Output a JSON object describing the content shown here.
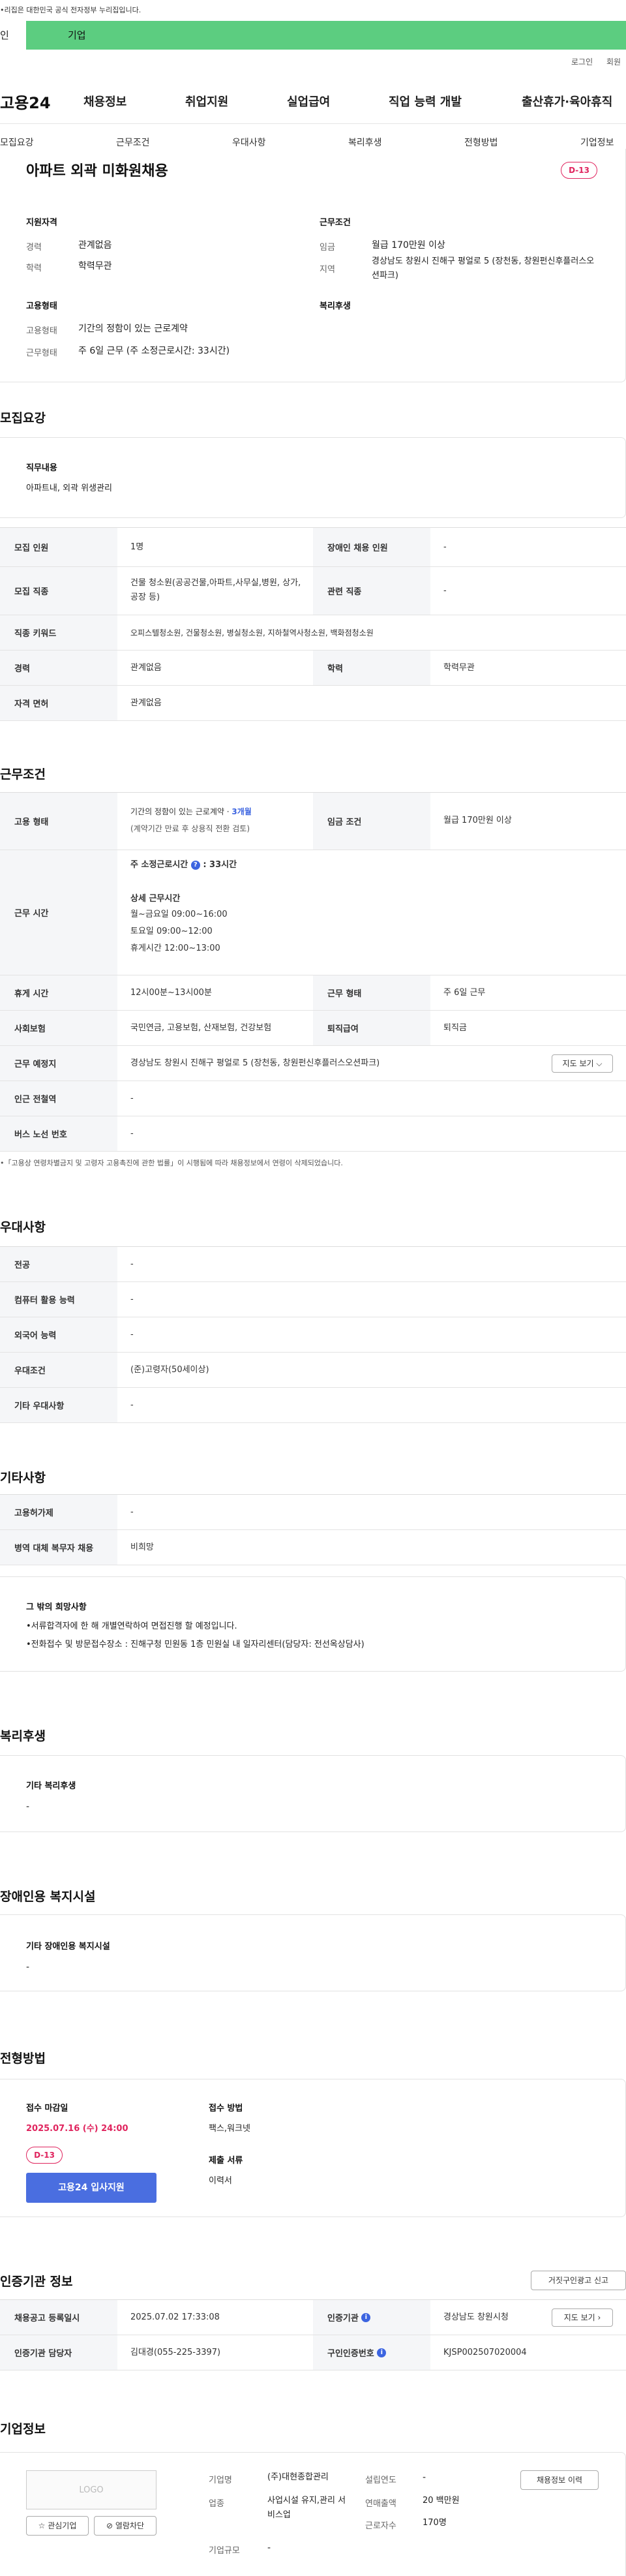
{
  "top": {
    "gov_notice": "•리집은 대한민국 공식 전자정부 누리집입니다.",
    "tab_personal": "인",
    "tab_company": "기업",
    "login": "로그인",
    "signup": "회원"
  },
  "gnb": {
    "logo": "고용24",
    "items": [
      "채용정보",
      "취업지원",
      "실업급여",
      "직업 능력 개발",
      "출산휴가·육아휴직"
    ]
  },
  "subnav": [
    "모집요강",
    "근무조건",
    "우대사항",
    "복리후생",
    "전형방법",
    "기업정보"
  ],
  "summary": {
    "title": "아파트 외곽 미화원채용",
    "dday": "D-13",
    "qual_title": "지원자격",
    "career_lbl": "경력",
    "career_val": "관계없음",
    "edu_lbl": "학력",
    "edu_val": "학력무관",
    "emp_title": "고용형태",
    "emp_lbl": "고용형태",
    "emp_val": "기간의 정함이 있는 근로계약",
    "work_lbl": "근무형태",
    "work_val": "주 6일 근무 (주 소정근로시간: 33시간)",
    "cond_title": "근무조건",
    "wage_lbl": "임금",
    "wage_val": "월급 170만원 이상",
    "region_lbl": "지역",
    "region_val": "경상남도 창원시 진해구 평얼로 5 (장천동, 창원펀신후플러스오션파크)",
    "welfare_title": "복리후생"
  },
  "recruit": {
    "title": "모집요강",
    "duty_title": "직무내용",
    "duty_val": "아파트내, 외곽 위생관리",
    "rows": {
      "count_lbl": "모집 인원",
      "count_val": "1명",
      "disabled_lbl": "장애인 채용 인원",
      "disabled_val": "-",
      "job_lbl": "모집 직종",
      "job_val": "건물 청소원(공공건물,아파트,사무실,병원, 상가,공장 등)",
      "related_lbl": "관련 직종",
      "related_val": "-",
      "keyword_lbl": "직종 키워드",
      "keyword_val": "오피스텔청소원, 건물청소원, 병실청소원, 지하철역사청소원, 백화점청소원",
      "career_lbl": "경력",
      "career_val": "관계없음",
      "edu_lbl": "학력",
      "edu_val": "학력무관",
      "license_lbl": "자격 면허",
      "license_val": "관계없음"
    }
  },
  "workcond": {
    "title": "근무조건",
    "emp_lbl": "고용 형태",
    "emp_val1": "기간의 정함이 있는 근로계약 · ",
    "emp_val_months": "3개월",
    "emp_val2": "(계약기간 만료 후 상용직 전환 검토)",
    "wage_lbl": "임금 조건",
    "wage_val": "월급 170만원 이상",
    "time_lbl": "근무 시간",
    "time_main_a": "주 소정근로시간",
    "time_main_b": ": 33시간",
    "time_detail_title": "상세 근무시간",
    "time_d1": "월~금요일 09:00~16:00",
    "time_d2": "토요일 09:00~12:00",
    "time_d3": "휴게시간 12:00~13:00",
    "rest_lbl": "휴게 시간",
    "rest_val": "12시00분~13시00분",
    "work_type_lbl": "근무 형태",
    "work_type_val": "주 6일 근무",
    "insurance_lbl": "사회보험",
    "insurance_val": "국민연금, 고용보험, 산재보험, 건강보험",
    "severance_lbl": "퇴직급여",
    "severance_val": "퇴직금",
    "place_lbl": "근무 예정지",
    "place_val": "경상남도 창원시 진해구 평얼로 5 (장천동, 창원펀신후플러스오션파크)",
    "map_btn": "지도 보기 ⌵",
    "station_lbl": "인근 전철역",
    "station_val": "-",
    "bus_lbl": "버스 노선 번호",
    "bus_val": "-",
    "note": "•「고용상 연령차별금지 및 고령자 고용촉진에 관한 법률」이 시행됨에 따라 채용정보에서 연령이 삭제되었습니다."
  },
  "pref": {
    "title": "우대사항",
    "r1_lbl": "전공",
    "r1_val": "-",
    "r2_lbl": "컴퓨터 활용 능력",
    "r2_val": "-",
    "r3_lbl": "외국어 능력",
    "r3_val": "-",
    "r4_lbl": "우대조건",
    "r4_val": "(준)고령자(50세이상)",
    "r5_lbl": "기타 우대사항",
    "r5_val": "-"
  },
  "etc": {
    "title": "기타사항",
    "r1_lbl": "고용허가제",
    "r1_val": "-",
    "r2_lbl": "병역 대체 복무자 채용",
    "r2_val": "비희망",
    "hope_title": "그 밖의 희망사항",
    "hope_l1": "•서류합격자에 한 해 개별연락하여 면접진행 할 예정입니다.",
    "hope_l2": "•전화접수 및 방문접수장소 : 진해구청 민원동 1층 민원실 내 일자리센터(담당자: 전선옥상담사)"
  },
  "welfare": {
    "title": "복리후생",
    "sub": "기타 복리후생",
    "val": "-"
  },
  "disabled": {
    "title": "장애인용 복지시설",
    "sub": "기타 장애인용 복지시설",
    "val": "-"
  },
  "process": {
    "title": "전형방법",
    "deadline_lbl": "접수 마감일",
    "deadline_val": "2025.07.16 (수) 24:00",
    "dday": "D-13",
    "apply_btn": "고용24 입사지원",
    "method_lbl": "접수 방법",
    "method_val": "팩스,워크넷",
    "docs_lbl": "제출 서류",
    "docs_val": "이력서"
  },
  "cert": {
    "title": "인증기관 정보",
    "report_btn": "거짓구인광고 신고",
    "r1_lbl": "채용공고 등록일시",
    "r1_val": "2025.07.02 17:33:08",
    "r2_lbl": "인증기관",
    "r2_val": "경상남도 창원시청",
    "map_btn": "지도 보기 ›",
    "r3_lbl": "인증기관 담당자",
    "r3_val": "김대경(055-225-3397)",
    "r4_lbl": "구인인증번호",
    "r4_val": "KJSP002507020004"
  },
  "company": {
    "title": "기업정보",
    "logo": "LOGO",
    "fav_btn": "☆ 관심기업",
    "block_btn": "⊘ 열람차단",
    "name_lbl": "기업명",
    "name_val": "(주)대현종합관리",
    "founded_lbl": "설립연도",
    "founded_val": "-",
    "industry_lbl": "업종",
    "industry_val": "사업시설 유지,관리 서비스업",
    "sales_lbl": "연매출액",
    "sales_val": "20 백만원",
    "size_lbl": "기업규모",
    "size_val": "-",
    "staff_lbl": "근로자수",
    "staff_val": "170명",
    "history_btn": "채용정보 이력"
  }
}
